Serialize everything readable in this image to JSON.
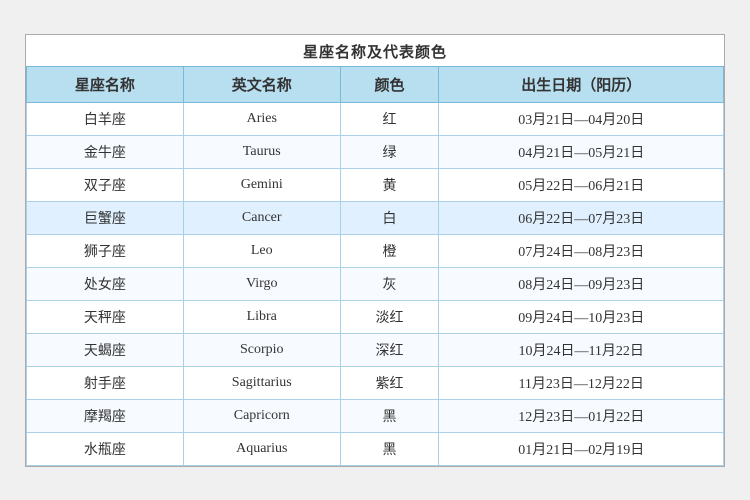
{
  "title": "星座名称及代表颜色",
  "headers": [
    "星座名称",
    "英文名称",
    "颜色",
    "出生日期（阳历）"
  ],
  "rows": [
    {
      "chinese": "白羊座",
      "english": "Aries",
      "color": "红",
      "dates": "03月21日—04月20日",
      "highlight": false
    },
    {
      "chinese": "金牛座",
      "english": "Taurus",
      "color": "绿",
      "dates": "04月21日—05月21日",
      "highlight": false
    },
    {
      "chinese": "双子座",
      "english": "Gemini",
      "color": "黄",
      "dates": "05月22日—06月21日",
      "highlight": false
    },
    {
      "chinese": "巨蟹座",
      "english": "Cancer",
      "color": "白",
      "dates": "06月22日—07月23日",
      "highlight": true
    },
    {
      "chinese": "狮子座",
      "english": "Leo",
      "color": "橙",
      "dates": "07月24日—08月23日",
      "highlight": false
    },
    {
      "chinese": "处女座",
      "english": "Virgo",
      "color": "灰",
      "dates": "08月24日—09月23日",
      "highlight": false
    },
    {
      "chinese": "天秤座",
      "english": "Libra",
      "color": "淡红",
      "dates": "09月24日—10月23日",
      "highlight": false
    },
    {
      "chinese": "天蝎座",
      "english": "Scorpio",
      "color": "深红",
      "dates": "10月24日—11月22日",
      "highlight": false
    },
    {
      "chinese": "射手座",
      "english": "Sagittarius",
      "color": "紫红",
      "dates": "11月23日—12月22日",
      "highlight": false
    },
    {
      "chinese": "摩羯座",
      "english": "Capricorn",
      "color": "黑",
      "dates": "12月23日—01月22日",
      "highlight": false
    },
    {
      "chinese": "水瓶座",
      "english": "Aquarius",
      "color": "黑",
      "dates": "01月21日—02月19日",
      "highlight": false
    }
  ]
}
